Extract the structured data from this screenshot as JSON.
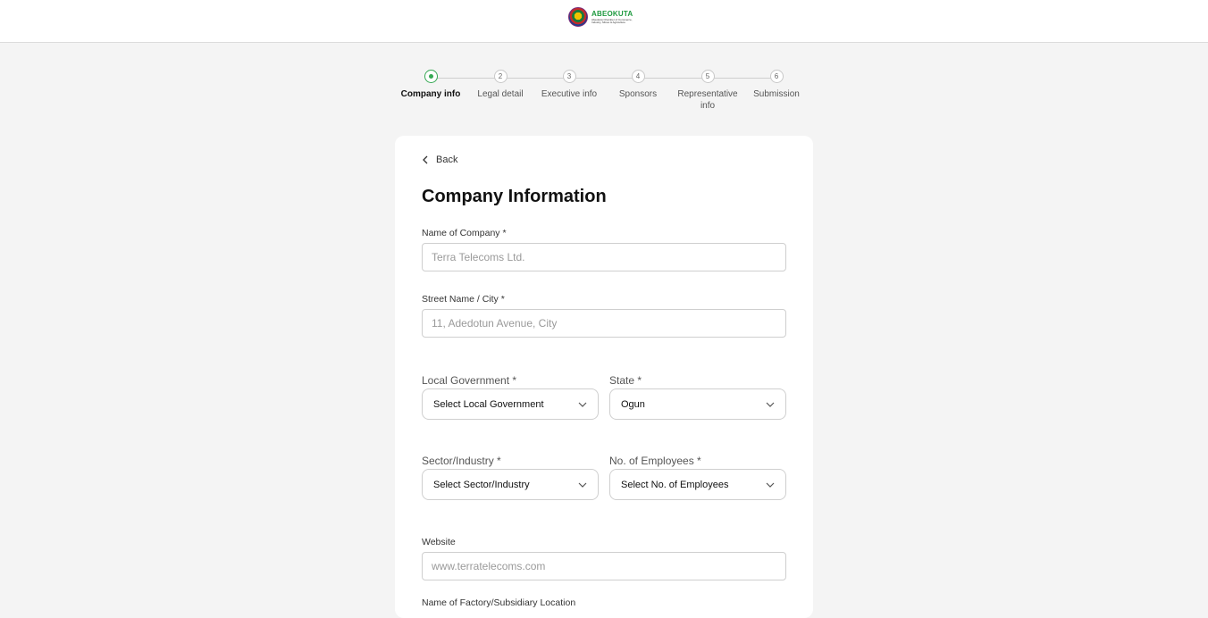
{
  "header": {
    "logo_name": "ABEOKUTA",
    "logo_subtitle": "Abeokuta Chamber of Commerce, Industry, Mines & Agriculture"
  },
  "stepper": {
    "steps": [
      {
        "number": "1",
        "label": "Company info",
        "active": true
      },
      {
        "number": "2",
        "label": "Legal detail",
        "active": false
      },
      {
        "number": "3",
        "label": "Executive info",
        "active": false
      },
      {
        "number": "4",
        "label": "Sponsors",
        "active": false
      },
      {
        "number": "5",
        "label": "Representative info",
        "active": false
      },
      {
        "number": "6",
        "label": "Submission",
        "active": false
      }
    ],
    "accent_color": "#35a853"
  },
  "form": {
    "back_label": "Back",
    "title": "Company Information",
    "company_name": {
      "label": "Name of Company *",
      "placeholder": "Terra Telecoms Ltd.",
      "value": ""
    },
    "street": {
      "label": "Street Name / City *",
      "placeholder": "11, Adedotun Avenue, City",
      "value": ""
    },
    "local_government": {
      "label": "Local Government *",
      "selected": "Select Local Government"
    },
    "state": {
      "label": "State *",
      "selected": "Ogun"
    },
    "sector": {
      "label": "Sector/Industry *",
      "selected": "Select Sector/Industry"
    },
    "employees": {
      "label": "No. of Employees *",
      "selected": "Select No. of Employees"
    },
    "website": {
      "label": "Website",
      "placeholder": "www.terratelecoms.com",
      "value": ""
    },
    "factory": {
      "label": "Name of Factory/Subsidiary Location"
    }
  }
}
